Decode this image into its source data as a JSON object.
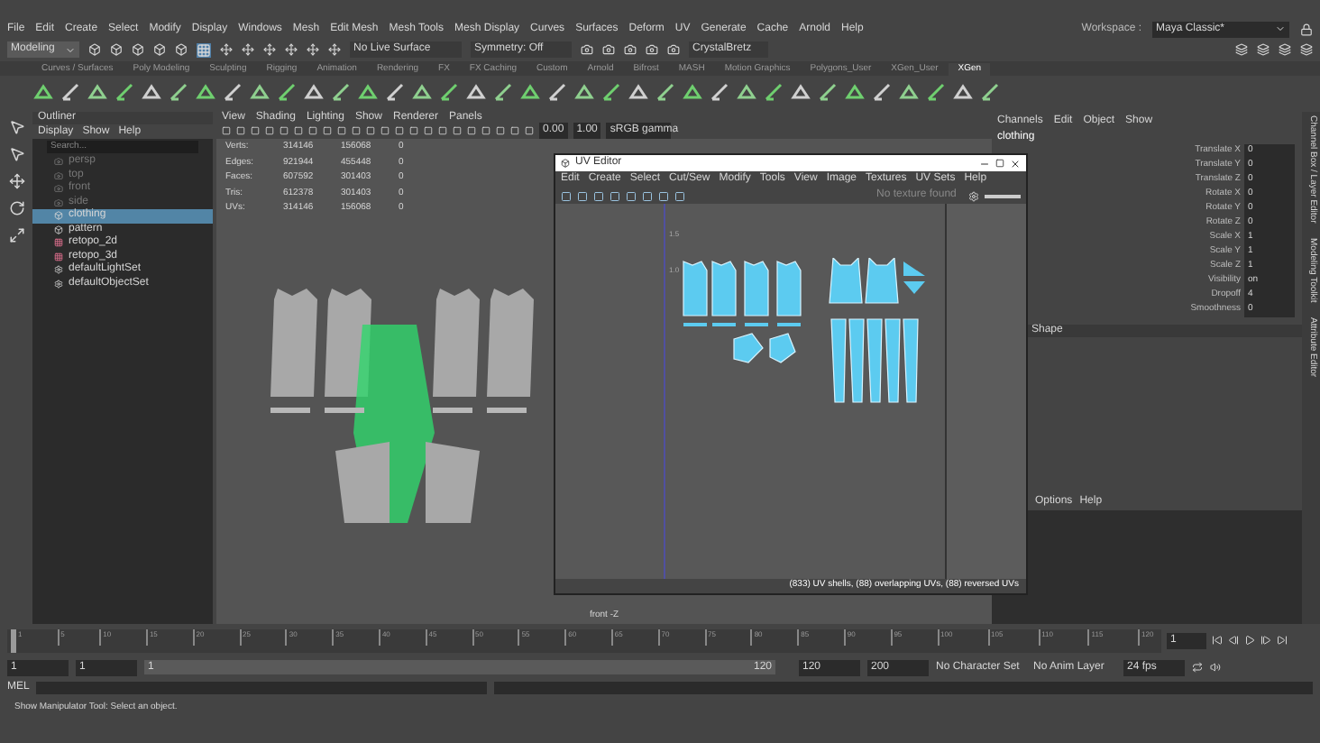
{
  "menubar": {
    "items": [
      "File",
      "Edit",
      "Create",
      "Select",
      "Modify",
      "Display",
      "Windows",
      "Mesh",
      "Edit Mesh",
      "Mesh Tools",
      "Mesh Display",
      "Curves",
      "Surfaces",
      "Deform",
      "UV",
      "Generate",
      "Cache",
      "Arnold",
      "Help"
    ],
    "workspace_label": "Workspace :",
    "workspace_value": "Maya Classic*"
  },
  "status_line": {
    "mode": "Modeling",
    "live_surface": "No Live Surface",
    "symmetry": "Symmetry: Off",
    "user": "CrystalBretz"
  },
  "shelf_tabs": [
    {
      "label": "Curves / Surfaces",
      "selected": false
    },
    {
      "label": "Poly Modeling",
      "selected": false
    },
    {
      "label": "Sculpting",
      "selected": false
    },
    {
      "label": "Rigging",
      "selected": false
    },
    {
      "label": "Animation",
      "selected": false
    },
    {
      "label": "Rendering",
      "selected": false
    },
    {
      "label": "FX",
      "selected": false
    },
    {
      "label": "FX Caching",
      "selected": false
    },
    {
      "label": "Custom",
      "selected": false
    },
    {
      "label": "Arnold",
      "selected": false
    },
    {
      "label": "Bifrost",
      "selected": false
    },
    {
      "label": "MASH",
      "selected": false
    },
    {
      "label": "Motion Graphics",
      "selected": false
    },
    {
      "label": "Polygons_User",
      "selected": false
    },
    {
      "label": "XGen_User",
      "selected": false
    },
    {
      "label": "XGen",
      "selected": true
    }
  ],
  "outliner": {
    "title": "Outliner",
    "menus": [
      "Display",
      "Show",
      "Help"
    ],
    "search": {
      "placeholder": "Search..."
    },
    "items": [
      {
        "label": "persp",
        "kind": "camera",
        "hidden": true,
        "selected": false
      },
      {
        "label": "top",
        "kind": "camera",
        "hidden": true,
        "selected": false
      },
      {
        "label": "front",
        "kind": "camera",
        "hidden": true,
        "selected": false
      },
      {
        "label": "side",
        "kind": "camera",
        "hidden": true,
        "selected": false
      },
      {
        "label": "clothing",
        "kind": "group",
        "hidden": false,
        "selected": true
      },
      {
        "label": "pattern",
        "kind": "group",
        "hidden": false,
        "selected": false
      },
      {
        "label": "retopo_2d",
        "kind": "mesh",
        "hidden": false,
        "selected": false
      },
      {
        "label": "retopo_3d",
        "kind": "mesh",
        "hidden": false,
        "selected": false
      },
      {
        "label": "defaultLightSet",
        "kind": "set",
        "hidden": false,
        "selected": false
      },
      {
        "label": "defaultObjectSet",
        "kind": "set",
        "hidden": false,
        "selected": false
      }
    ]
  },
  "viewport": {
    "menus": [
      "View",
      "Shading",
      "Lighting",
      "Show",
      "Renderer",
      "Panels"
    ],
    "exposure": "0.00",
    "gamma": "1.00",
    "color_space": "sRGB gamma",
    "stats": [
      [
        "Verts:",
        "314146",
        "156068",
        "0"
      ],
      [
        "Edges:",
        "921944",
        "455448",
        "0"
      ],
      [
        "Faces:",
        "607592",
        "301403",
        "0"
      ],
      [
        "Tris:",
        "612378",
        "301403",
        "0"
      ],
      [
        "UVs:",
        "314146",
        "156068",
        "0"
      ]
    ],
    "camera_label": "front -Z"
  },
  "uv_editor": {
    "title": "UV Editor",
    "menus": [
      "Edit",
      "Create",
      "Select",
      "Cut/Sew",
      "Modify",
      "Tools",
      "View",
      "Image",
      "Textures",
      "UV Sets",
      "Help"
    ],
    "texture_status": "No texture found",
    "axis_labels": [
      "1.5",
      "1.0"
    ],
    "status": "(833) UV shells, (88) overlapping UVs, (88) reversed UVs"
  },
  "channel_box": {
    "menus": [
      "Channels",
      "Edit",
      "Object",
      "Show"
    ],
    "object_name": "clothing",
    "attributes": [
      [
        "Translate X",
        "0"
      ],
      [
        "Translate Y",
        "0"
      ],
      [
        "Translate Z",
        "0"
      ],
      [
        "Rotate X",
        "0"
      ],
      [
        "Rotate Y",
        "0"
      ],
      [
        "Rotate Z",
        "0"
      ],
      [
        "Scale X",
        "1"
      ],
      [
        "Scale Y",
        "1"
      ],
      [
        "Scale Z",
        "1"
      ],
      [
        "Visibility",
        "on"
      ],
      [
        "Dropoff",
        "4"
      ],
      [
        "Smoothness",
        "0"
      ]
    ],
    "shape_header": "Shape",
    "layer_menus": [
      "Options",
      "Help"
    ]
  },
  "side_tabs": [
    "Channel Box / Layer Editor",
    "Modeling Toolkit",
    "Attribute Editor"
  ],
  "timeline": {
    "ticks": [
      "1",
      "5",
      "10",
      "15",
      "20",
      "25",
      "30",
      "35",
      "40",
      "45",
      "50",
      "55",
      "60",
      "65",
      "70",
      "75",
      "80",
      "85",
      "90",
      "95",
      "100",
      "105",
      "110",
      "115",
      "120"
    ],
    "current_frame": "1",
    "level": 0
  },
  "range": {
    "start": "1",
    "inner_start": "1",
    "slider_start": "1",
    "slider_end": "120",
    "level": 1,
    "end": "120",
    "max_end": "200",
    "character_set": "No Character Set",
    "anim_layer": "No Anim Layer",
    "fps": "24 fps"
  },
  "command_line": {
    "label": "MEL"
  },
  "help_line": "Show Manipulator Tool: Select an object."
}
